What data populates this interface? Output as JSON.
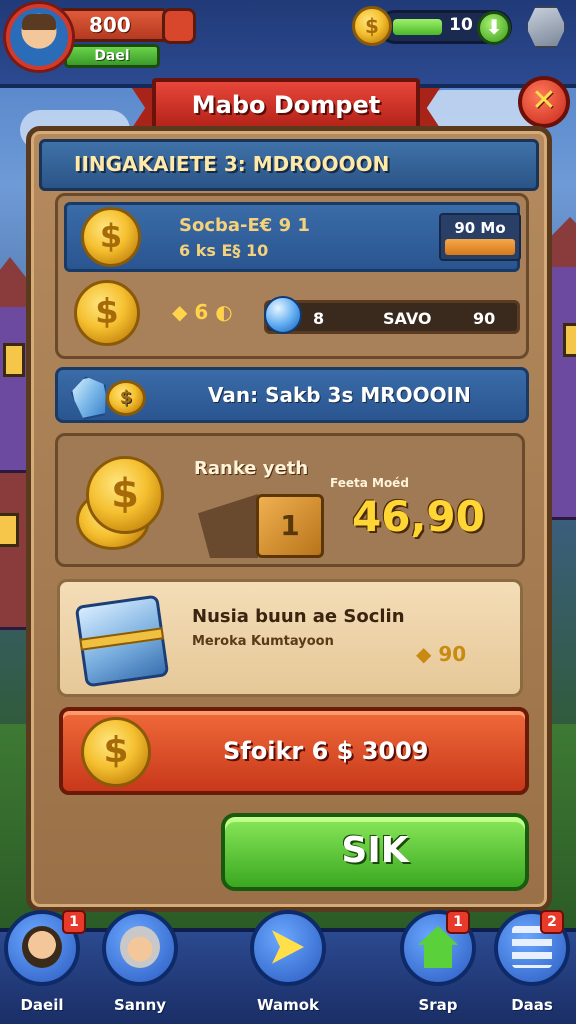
{
  "header": {
    "coins": "800",
    "player_name": "Dael",
    "energy": "10",
    "energy_fill": 0.45
  },
  "title": "Mabo Dompet",
  "close_label": "✕",
  "panel": {
    "header": "IINGAKAIETE 3: MDROOOON",
    "offer1": {
      "line1": "Socba-E€ 9 1",
      "line2": "6 ks E§ 10",
      "badge": "90 Mo"
    },
    "offer2": {
      "amount": "6",
      "track": [
        "8",
        "SAVO",
        "90"
      ]
    },
    "section2": "Van: Sakb 3s MROOOIN",
    "reward": {
      "label": "Ranke yeth",
      "sub": "Feeta Moéd",
      "box": "1",
      "value": "46,90"
    },
    "bundle": {
      "line1": "Nusia buun ae Soclin",
      "line2": "Meroka Kumtayoon",
      "price": "90"
    },
    "buy_label": "Sfoikr 6  $ 3009",
    "ok_label": "SIK"
  },
  "nav": [
    {
      "label": "Daeil",
      "badge": "1",
      "icon": "avatar-icon"
    },
    {
      "label": "Sanny",
      "badge": "",
      "icon": "character-icon"
    },
    {
      "label": "Wamok",
      "badge": "",
      "icon": "arrow-right-icon"
    },
    {
      "label": "Srap",
      "badge": "1",
      "icon": "home-icon"
    },
    {
      "label": "Daas",
      "badge": "2",
      "icon": "menu-icon"
    }
  ]
}
